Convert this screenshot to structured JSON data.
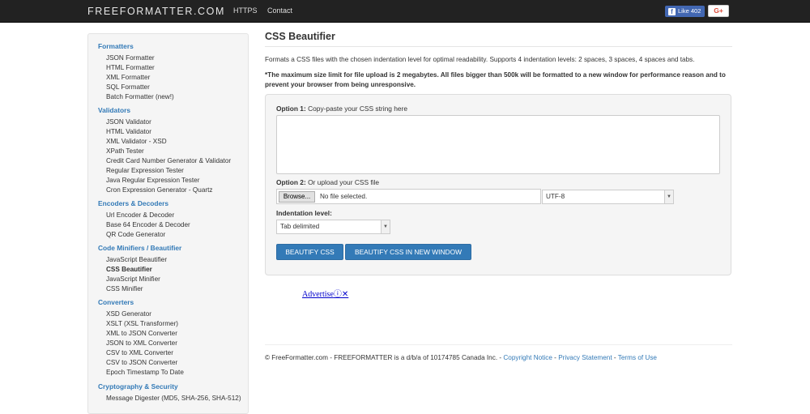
{
  "header": {
    "brand": "FREEFORMATTER.COM",
    "nav": [
      "HTTPS",
      "Contact"
    ],
    "fb_like_label": "Like",
    "fb_like_count": "402",
    "gplus_label": "G+"
  },
  "sidebar": {
    "sections": [
      {
        "title": "Formatters",
        "items": [
          "JSON Formatter",
          "HTML Formatter",
          "XML Formatter",
          "SQL Formatter",
          "Batch Formatter (new!)"
        ]
      },
      {
        "title": "Validators",
        "items": [
          "JSON Validator",
          "HTML Validator",
          "XML Validator - XSD",
          "XPath Tester",
          "Credit Card Number Generator & Validator",
          "Regular Expression Tester",
          "Java Regular Expression Tester",
          "Cron Expression Generator - Quartz"
        ]
      },
      {
        "title": "Encoders & Decoders",
        "items": [
          "Url Encoder & Decoder",
          "Base 64 Encoder & Decoder",
          "QR Code Generator"
        ]
      },
      {
        "title": "Code Minifiers / Beautifier",
        "items": [
          "JavaScript Beautifier",
          "CSS Beautifier",
          "JavaScript Minifier",
          "CSS Minifier"
        ]
      },
      {
        "title": "Converters",
        "items": [
          "XSD Generator",
          "XSLT (XSL Transformer)",
          "XML to JSON Converter",
          "JSON to XML Converter",
          "CSV to XML Converter",
          "CSV to JSON Converter",
          "Epoch Timestamp To Date"
        ]
      },
      {
        "title": "Cryptography & Security",
        "items": [
          "Message Digester (MD5, SHA-256, SHA-512)"
        ]
      }
    ],
    "active_item": "CSS Beautifier"
  },
  "main": {
    "title": "CSS Beautifier",
    "description": "Formats a CSS files with the chosen indentation level for optimal readability. Supports 4 indentation levels: 2 spaces, 3 spaces, 4 spaces and tabs.",
    "warning": "*The maximum size limit for file upload is 2 megabytes. All files bigger than 500k will be formatted to a new window for performance reason and to prevent your browser from being unresponsive.",
    "option1_label": "Option 1:",
    "option1_text": "Copy-paste your CSS string here",
    "textarea_value": "",
    "option2_label": "Option 2:",
    "option2_text": "Or upload your CSS file",
    "browse_label": "Browse...",
    "file_status": "No file selected.",
    "encoding_value": "UTF-8",
    "indentation_label": "Indentation level:",
    "indentation_value": "Tab delimited",
    "beautify_button": "BEAUTIFY CSS",
    "beautify_new_window_button": "BEAUTIFY CSS IN NEW WINDOW"
  },
  "advertise": {
    "label": "Advertise",
    "icons": "ⓘ✕"
  },
  "footer": {
    "text": "© FreeFormatter.com - FREEFORMATTER is a d/b/a of 10174785 Canada Inc. - ",
    "links": [
      "Copyright Notice",
      "Privacy Statement",
      "Terms of Use"
    ],
    "sep": " - "
  },
  "colors": {
    "topbar": "#222222",
    "accent": "#337ab7",
    "facebook": "#4267b2"
  }
}
